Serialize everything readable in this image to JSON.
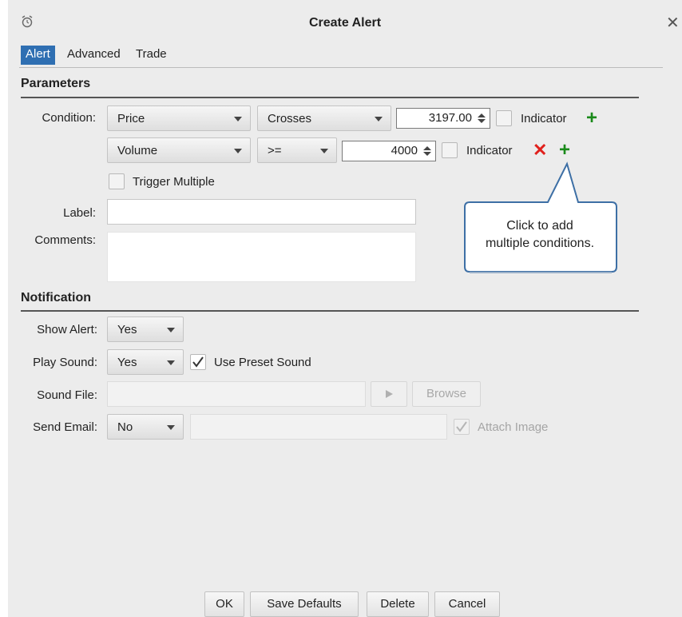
{
  "window": {
    "title": "Create Alert"
  },
  "tabs": [
    {
      "label": "Alert"
    },
    {
      "label": "Advanced"
    },
    {
      "label": "Trade"
    }
  ],
  "parameters": {
    "heading": "Parameters",
    "condition_label": "Condition:",
    "row1": {
      "field": "Price",
      "operator": "Crosses",
      "value": "3197.00",
      "indicator_label": "Indicator"
    },
    "row2": {
      "field": "Volume",
      "operator": ">=",
      "value": "4000",
      "indicator_label": "Indicator"
    },
    "trigger_multiple_label": "Trigger Multiple",
    "label_label": "Label:",
    "label_value": "",
    "comments_label": "Comments:",
    "comments_value": ""
  },
  "callout": {
    "line1": "Click to add",
    "line2": "multiple conditions."
  },
  "notification": {
    "heading": "Notification",
    "show_alert_label": "Show Alert:",
    "show_alert_value": "Yes",
    "play_sound_label": "Play Sound:",
    "play_sound_value": "Yes",
    "use_preset_label": "Use Preset Sound",
    "use_preset_checked": true,
    "sound_file_label": "Sound File:",
    "sound_file_value": "",
    "browse_label": "Browse",
    "send_email_label": "Send Email:",
    "send_email_value": "No",
    "email_value": "",
    "attach_image_label": "Attach Image",
    "attach_image_checked": true
  },
  "buttons": {
    "ok": "OK",
    "save_defaults": "Save Defaults",
    "delete": "Delete",
    "cancel": "Cancel"
  },
  "colors": {
    "tab_active": "#2f6fb2",
    "add": "#1a8a1a",
    "remove": "#e0201c",
    "callout_border": "#3d6fa5"
  }
}
